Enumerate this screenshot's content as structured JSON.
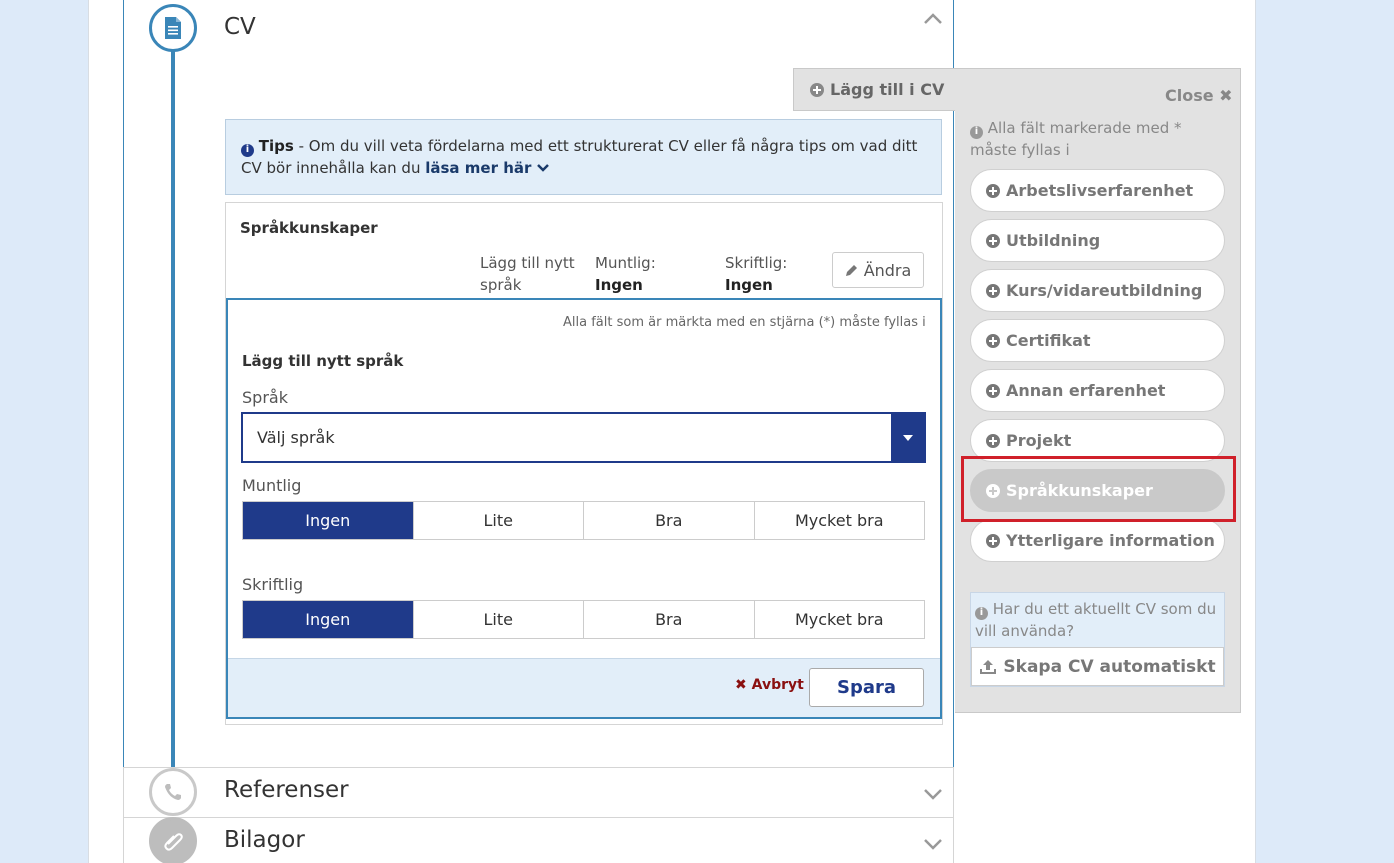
{
  "cv": {
    "title": "CV",
    "tips": {
      "bold": "Tips",
      "text": " - Om du vill veta fördelarna med ett strukturerat CV eller få några tips om vad ditt CV bör innehålla kan du ",
      "link": "läsa mer här"
    },
    "language_card": {
      "title": "Språkkunskaper",
      "col_new": "Lägg till nytt språk",
      "col_oral_label": "Muntlig:",
      "col_oral_value": "Ingen",
      "col_written_label": "Skriftlig:",
      "col_written_value": "Ingen",
      "edit_button": "Ändra"
    },
    "form": {
      "required_note": "Alla fält som är märkta med en stjärna (*) måste fyllas i",
      "heading": "Lägg till nytt språk",
      "language_label": "Språk",
      "language_value": "Välj språk",
      "oral_label": "Muntlig",
      "written_label": "Skriftlig",
      "levels": [
        "Ingen",
        "Lite",
        "Bra",
        "Mycket bra"
      ],
      "oral_selected": "Ingen",
      "written_selected": "Ingen",
      "cancel": "Avbryt",
      "save": "Spara"
    }
  },
  "sections": {
    "references": "Referenser",
    "attachments": "Bilagor"
  },
  "side_panel": {
    "tab_label": "Lägg till i CV",
    "close": "Close",
    "info": "Alla fält markerade med * måste fyllas i",
    "items": [
      "Arbetslivserfarenhet",
      "Utbildning",
      "Kurs/vidareutbildning",
      "Certifikat",
      "Annan erfarenhet",
      "Projekt",
      "Språkkunskaper",
      "Ytterligare information"
    ],
    "active_item": "Språkkunskaper",
    "auto_text": "Har du ett aktuellt CV som du vill använda?",
    "auto_button": "Skapa CV automatiskt"
  },
  "colors": {
    "accent_blue": "#3a86b8",
    "selected_navy": "#1f3a8a",
    "highlight_red": "#d0202a"
  }
}
